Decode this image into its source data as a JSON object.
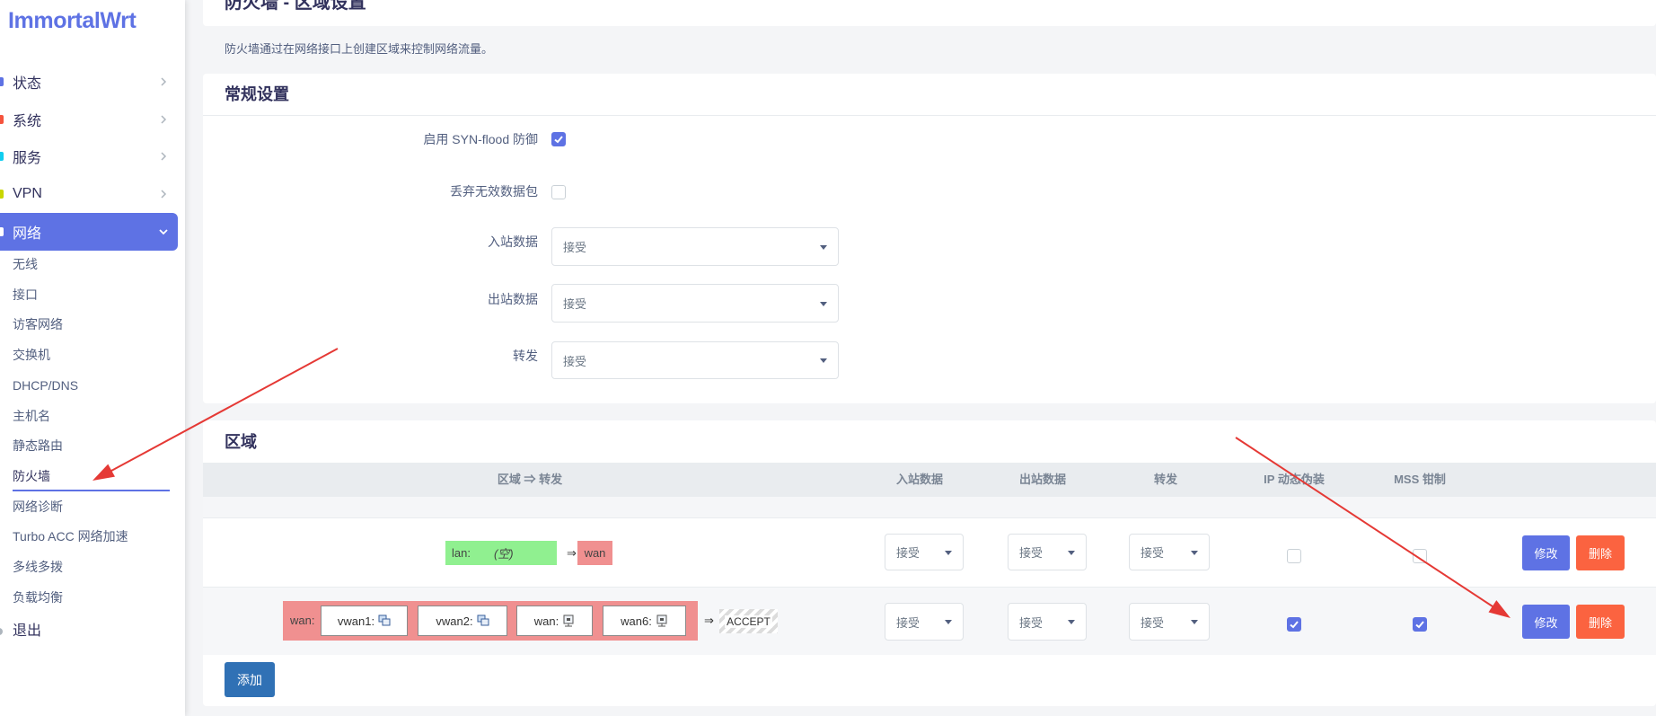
{
  "brand": {
    "logo_text": "ImmortalWrt",
    "accent": "#5e72e4"
  },
  "sidebar": {
    "menu": [
      {
        "label": "状态",
        "icon": "status-icon",
        "color": "#5e72e4"
      },
      {
        "label": "系统",
        "icon": "system-icon",
        "color": "#f5533d"
      },
      {
        "label": "服务",
        "icon": "services-icon",
        "color": "#11cdef"
      },
      {
        "label": "VPN",
        "icon": "vpn-icon",
        "color": "#c9d600"
      },
      {
        "label": "网络",
        "icon": "network-icon",
        "color": "#ffffff",
        "active": true
      }
    ],
    "submenu": [
      {
        "label": "无线"
      },
      {
        "label": "接口"
      },
      {
        "label": "访客网络"
      },
      {
        "label": "交换机"
      },
      {
        "label": "DHCP/DNS"
      },
      {
        "label": "主机名"
      },
      {
        "label": "静态路由"
      },
      {
        "label": "防火墙",
        "active": true
      },
      {
        "label": "网络诊断"
      },
      {
        "label": "Turbo ACC 网络加速"
      },
      {
        "label": "多线多拨"
      },
      {
        "label": "负载均衡"
      }
    ],
    "logout": {
      "label": "退出",
      "icon": "logout-icon",
      "color": "#adb5bd"
    }
  },
  "page": {
    "title": "防火墙 - 区域设置",
    "description": "防火墙通过在网络接口上创建区域来控制网络流量。"
  },
  "general": {
    "title": "常规设置",
    "syn_flood": {
      "label": "启用 SYN-flood 防御",
      "checked": true
    },
    "drop_invalid": {
      "label": "丢弃无效数据包",
      "checked": false
    },
    "input": {
      "label": "入站数据",
      "value": "接受"
    },
    "output": {
      "label": "出站数据",
      "value": "接受"
    },
    "forward": {
      "label": "转发",
      "value": "接受"
    }
  },
  "zones": {
    "title": "区域",
    "columns": {
      "zone_forward": "区域 ⇒ 转发",
      "input": "入站数据",
      "output": "出站数据",
      "forward": "转发",
      "masq": "IP 动态伪装",
      "mss": "MSS 钳制"
    },
    "rows": [
      {
        "zone": "lan:",
        "empty_label": "(空)",
        "color": "#90f090",
        "arrow": "⇒",
        "forward_to": "wan",
        "forward_color": "#f09090",
        "input": "接受",
        "output": "接受",
        "forward": "接受",
        "masq": false,
        "mss": false,
        "edit": "修改",
        "delete": "删除"
      },
      {
        "zone": "wan:",
        "color": "#f09090",
        "networks": [
          {
            "name": "vwan1:",
            "icon": "vlan-device-icon"
          },
          {
            "name": "vwan2:",
            "icon": "vlan-device-icon"
          },
          {
            "name": "wan:",
            "icon": "ethernet-port-icon"
          },
          {
            "name": "wan6:",
            "icon": "ethernet-port-icon"
          }
        ],
        "arrow": "⇒",
        "forward_to": "ACCEPT",
        "input": "接受",
        "output": "接受",
        "forward": "接受",
        "masq": true,
        "mss": true,
        "edit": "修改",
        "delete": "删除"
      }
    ],
    "add_label": "添加"
  },
  "annotations": {
    "arrow_color": "#e53935"
  }
}
